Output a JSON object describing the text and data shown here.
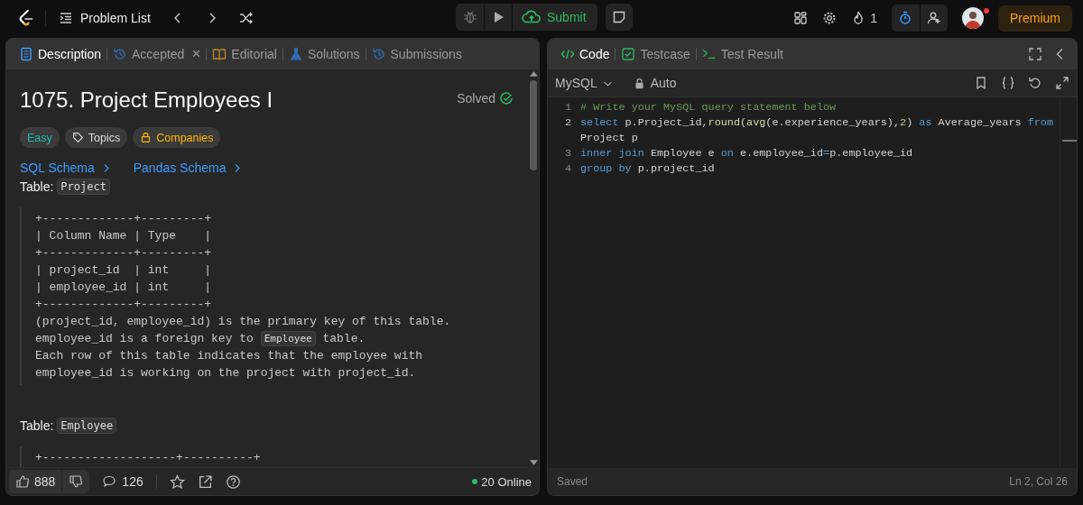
{
  "topbar": {
    "problem_list": "Problem List",
    "submit": "Submit",
    "streak": "1",
    "premium": "Premium",
    "notification_dot": true
  },
  "left_panel": {
    "tabs": [
      {
        "label": "Description",
        "selected": true
      },
      {
        "label": "Accepted",
        "selected": false,
        "close": "×"
      },
      {
        "label": "Editorial",
        "selected": false
      },
      {
        "label": "Solutions",
        "selected": false
      },
      {
        "label": "Submissions",
        "selected": false
      }
    ],
    "title": "1075. Project Employees I",
    "status": "Solved",
    "tags": [
      {
        "label": "Easy",
        "kind": "difficulty"
      },
      {
        "label": "Topics",
        "kind": "topics"
      },
      {
        "label": "Companies",
        "kind": "companies"
      }
    ],
    "links": [
      "SQL Schema",
      "Pandas Schema"
    ],
    "tables": [
      {
        "label": "Table:",
        "name": "Project",
        "block": [
          [
            {
              "text": "+-------------+---------+",
              "kind": "plain"
            }
          ],
          [
            {
              "text": "| Column Name | Type    |",
              "kind": "plain"
            }
          ],
          [
            {
              "text": "+-------------+---------+",
              "kind": "plain"
            }
          ],
          [
            {
              "text": "| project_id  | int     |",
              "kind": "plain"
            }
          ],
          [
            {
              "text": "| employee_id | int     |",
              "kind": "plain"
            }
          ],
          [
            {
              "text": "+-------------+---------+",
              "kind": "plain"
            }
          ],
          [
            {
              "text": "(project_id, employee_id) is the primary key of this table.",
              "kind": "plain"
            }
          ],
          [
            {
              "text": "employee_id is a foreign key to ",
              "kind": "plain"
            },
            {
              "text": "Employee",
              "kind": "code"
            },
            {
              "text": " table.",
              "kind": "plain"
            }
          ],
          [
            {
              "text": "Each row of this table indicates that the employee with",
              "kind": "plain"
            }
          ],
          [
            {
              "text": "employee_id is working on the project with project_id.",
              "kind": "plain"
            }
          ]
        ]
      },
      {
        "label": "Table:",
        "name": "Employee",
        "block": [
          [
            {
              "text": "+-------------------+----------+",
              "kind": "plain"
            }
          ]
        ]
      }
    ],
    "footer": {
      "likes": "888",
      "comments": "126",
      "online": "20 Online"
    }
  },
  "right_panel": {
    "tabs": [
      {
        "label": "Code",
        "selected": true
      },
      {
        "label": "Testcase",
        "selected": false
      },
      {
        "label": "Test Result",
        "selected": false
      }
    ],
    "language": "MySQL",
    "mode": "Auto",
    "code": [
      {
        "number": "1",
        "rows": [
          [
            {
              "text": "# Write your MySQL query statement below",
              "kind": "comment"
            }
          ]
        ]
      },
      {
        "number": "2",
        "rows": [
          [
            {
              "text": "select",
              "kind": "keyword"
            },
            {
              "text": " p.Project_id,",
              "kind": "plain"
            },
            {
              "text": "round",
              "kind": "function"
            },
            {
              "text": "(",
              "kind": "plain"
            },
            {
              "text": "avg",
              "kind": "function"
            },
            {
              "text": "(e.experience_years),",
              "kind": "plain"
            },
            {
              "text": "2",
              "kind": "number"
            },
            {
              "text": ") ",
              "kind": "plain"
            },
            {
              "text": "as",
              "kind": "keyword"
            },
            {
              "text": " Average_years ",
              "kind": "plain"
            },
            {
              "text": "from",
              "kind": "keyword"
            }
          ],
          [
            {
              "text": "Project p",
              "kind": "plain"
            }
          ]
        ]
      },
      {
        "number": "3",
        "rows": [
          [
            {
              "text": "inner join",
              "kind": "keyword"
            },
            {
              "text": " Employee e ",
              "kind": "plain"
            },
            {
              "text": "on",
              "kind": "keyword"
            },
            {
              "text": " e.employee_id",
              "kind": "plain"
            },
            {
              "text": "=",
              "kind": "keyword"
            },
            {
              "text": "p.employee_id",
              "kind": "plain"
            }
          ]
        ]
      },
      {
        "number": "4",
        "rows": [
          [
            {
              "text": "group by",
              "kind": "keyword"
            },
            {
              "text": " p.project_id",
              "kind": "plain"
            }
          ]
        ]
      }
    ],
    "status": "Saved",
    "cursor": "Ln 2, Col 26"
  }
}
